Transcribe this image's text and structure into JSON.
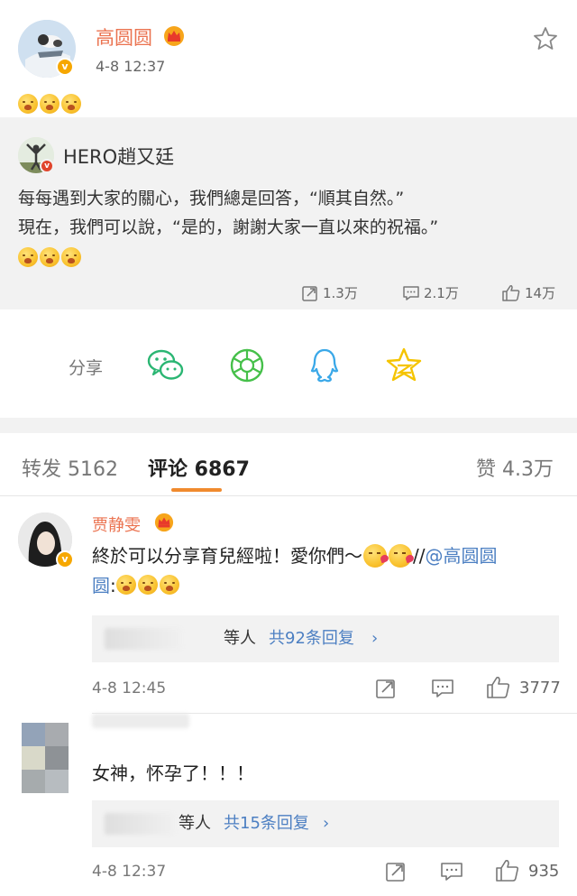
{
  "post": {
    "username": "高圆圆",
    "timestamp": "4-8 12:37",
    "verified_badge": "v",
    "emoji_count": 3,
    "emoji_icon": "crying-face-emoji"
  },
  "repost": {
    "username": "HERO趙又廷",
    "line1": "每每遇到大家的關心，我們總是回答，“順其自然。”",
    "line2": "現在，我們可以說，“是的，謝謝大家一直以來的祝福。”",
    "reposts": "1.3万",
    "comments": "2.1万",
    "likes": "14万"
  },
  "share": {
    "label": "分享",
    "targets": [
      "wechat-icon",
      "moments-icon",
      "qq-icon",
      "qzone-icon"
    ]
  },
  "tabs": {
    "repost": "转发 5162",
    "comment": "评论 6867",
    "like": "赞 4.3万"
  },
  "comments": [
    {
      "username": "贾静雯",
      "text_part1": "終於可以分享育兒經啦！愛你們～",
      "text_part2": "//",
      "mention": "@高圆圆",
      "mention_wrap": "圆",
      "colon": ":",
      "reply_suffix": "等人",
      "reply_total": "共92条回复",
      "time": "4-8 12:45",
      "likes": "3777"
    },
    {
      "username": "",
      "text": "女神，怀孕了！！！",
      "reply_suffix": "等人",
      "reply_total": "共15条回复",
      "time": "4-8 12:37",
      "likes": "935"
    }
  ],
  "colors": {
    "accent_orange": "#eb7350",
    "link_blue": "#4c7fc2",
    "tab_underline": "#f08a2e",
    "wechat_green": "#2bb673",
    "qq_blue": "#3aa8e8",
    "qzone_yellow": "#f5c400"
  }
}
